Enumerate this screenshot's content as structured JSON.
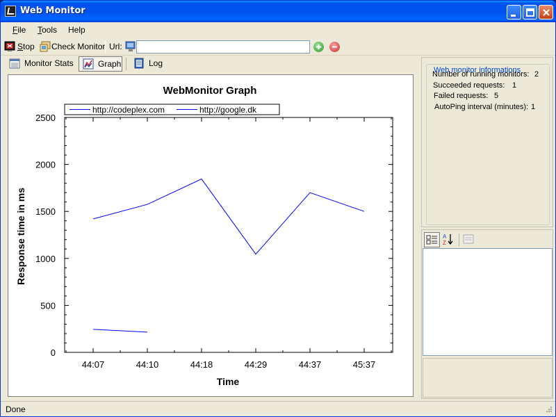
{
  "window": {
    "title": "Web Monitor"
  },
  "menu": {
    "file": {
      "key": "F",
      "rest": "ile"
    },
    "tools": {
      "key": "T",
      "rest": "ools"
    },
    "help": {
      "key": "",
      "rest": "Help"
    }
  },
  "toolbar": {
    "stop_key": "S",
    "stop_rest": "top",
    "check_monitor_label": "Check Monitor",
    "url_label": "Url:",
    "url_value": ""
  },
  "tabs": [
    {
      "label": "Monitor Stats",
      "active": false
    },
    {
      "label": "Graph",
      "active": true
    },
    {
      "label": "Log",
      "active": false
    }
  ],
  "info": {
    "title": "Web monitor informations",
    "rows": [
      {
        "label": "Number of running  monitors:",
        "value": "2"
      },
      {
        "label": "Succeeded requests:",
        "value": "1"
      },
      {
        "label": "Failed requests:",
        "value": "5"
      },
      {
        "label": "AutoPing interval (minutes):",
        "value": "1"
      }
    ]
  },
  "status": {
    "text": "Done"
  },
  "colors": {
    "series_line": "#0000FF",
    "titlebar": "#0053EE",
    "add_button": "#3BAA3B",
    "remove_button": "#E04040"
  },
  "chart_data": {
    "type": "line",
    "title": "WebMonitor Graph",
    "xlabel": "Time",
    "ylabel": "Response time in ms",
    "categories": [
      "44:07",
      "44:10",
      "44:18",
      "44:29",
      "44:37",
      "45:37"
    ],
    "ylim": [
      0,
      2500
    ],
    "yticks": [
      0,
      500,
      1000,
      1500,
      2000,
      2500
    ],
    "legend": "top",
    "grid": false,
    "series": [
      {
        "name": "http://codeplex.com",
        "values": [
          1420,
          1575,
          1845,
          1045,
          1700,
          1500
        ]
      },
      {
        "name": "http://google.dk",
        "values": [
          245,
          215,
          null,
          null,
          null,
          null
        ]
      }
    ]
  }
}
